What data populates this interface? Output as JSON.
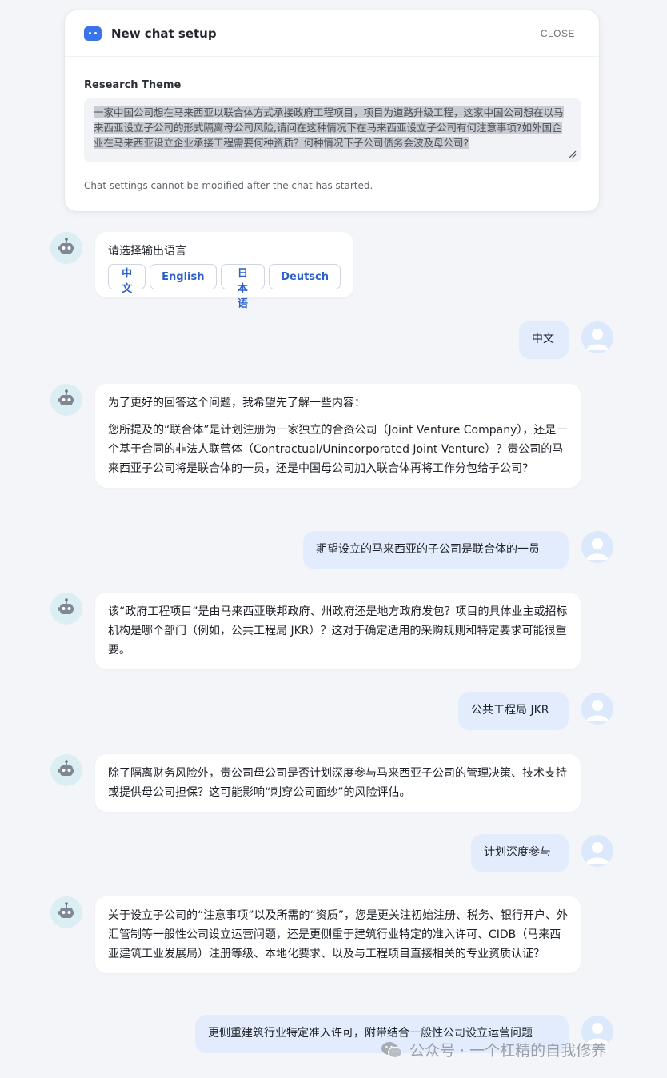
{
  "setup": {
    "title": "New chat setup",
    "close_label": "CLOSE",
    "theme_label": "Research Theme",
    "theme_text": "一家中国公司想在马来西亚以联合体方式承接政府工程项目，项目为道路升级工程，这家中国公司想在以马来西亚设立子公司的形式隔离母公司风险,请问在这种情况下在马来西亚设立子公司有何注意事项?如外国企业在马来西亚设立企业承接工程需要何种资质？何种情况下子公司债务会波及母公司?",
    "note": "Chat settings cannot be modified after the chat has started."
  },
  "messages": {
    "m1": {
      "prompt": "请选择输出语言",
      "options": [
        "中文",
        "English",
        "日本语",
        "Deutsch"
      ]
    },
    "m2": "中文",
    "m3": {
      "p1": "为了更好的回答这个问题，我希望先了解一些内容：",
      "p2": "您所提及的“联合体”是计划注册为一家独立的合资公司（Joint Venture Company），还是一个基于合同的非法人联营体（Contractual/Unincorporated Joint Venture）？贵公司的马来西亚子公司将是联合体的一员，还是中国母公司加入联合体再将工作分包给子公司?"
    },
    "m4": "期望设立的马来西亚的子公司是联合体的一员",
    "m5": "该“政府工程项目”是由马来西亚联邦政府、州政府还是地方政府发包？项目的具体业主或招标机构是哪个部门（例如，公共工程局 JKR）？这对于确定适用的采购规则和特定要求可能很重要。",
    "m6": "公共工程局 JKR",
    "m7": "除了隔离财务风险外，贵公司母公司是否计划深度参与马来西亚子公司的管理决策、技术支持或提供母公司担保？这可能影响“刺穿公司面纱”的风险评估。",
    "m8": "计划深度参与",
    "m9": "关于设立子公司的“注意事项”以及所需的“资质”，您是更关注初始注册、税务、银行开户、外汇管制等一般性公司设立运营问题，还是更侧重于建筑行业特定的准入许可、CIDB（马来西亚建筑工业发展局）注册等级、本地化要求、以及与工程项目直接相关的专业资质认证？",
    "m10": "更侧重建筑行业特定准入许可，附带结合一般性公司设立运营问题"
  },
  "watermark": "公众号 · 一个杠精的自我修养",
  "colors": {
    "accent": "#3b73e8",
    "user_bubble": "#e3ecfd",
    "page_bg": "#f3f5f9"
  }
}
